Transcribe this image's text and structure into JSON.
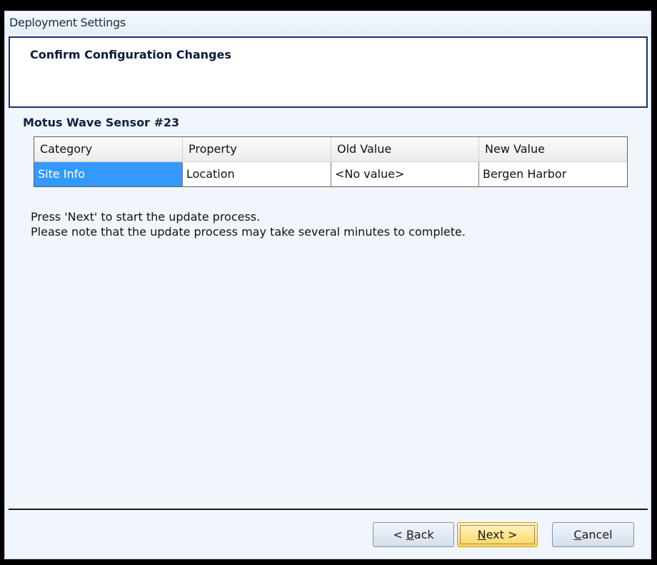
{
  "window": {
    "title": "Deployment Settings"
  },
  "header": {
    "title": "Confirm Configuration Changes"
  },
  "device": {
    "name": "Motus Wave Sensor #23"
  },
  "changes_table": {
    "columns": [
      "Category",
      "Property",
      "Old Value",
      "New Value"
    ],
    "rows": [
      [
        "Site Info",
        "Location",
        "<No value>",
        "Bergen Harbor"
      ]
    ],
    "selected_cell": "Site Info"
  },
  "instructions": {
    "line1": "Press 'Next' to start the update process.",
    "line2": "Please note that the update process may take several minutes to complete."
  },
  "buttons": {
    "back_prefix": "< ",
    "back_key": "B",
    "back_rest": "ack",
    "next_key": "N",
    "next_rest": "ext >",
    "cancel_key": "C",
    "cancel_rest": "ancel"
  },
  "colors": {
    "selection": "#3399ff",
    "header_border": "#1d2f68",
    "default_button": "#ffd760"
  }
}
